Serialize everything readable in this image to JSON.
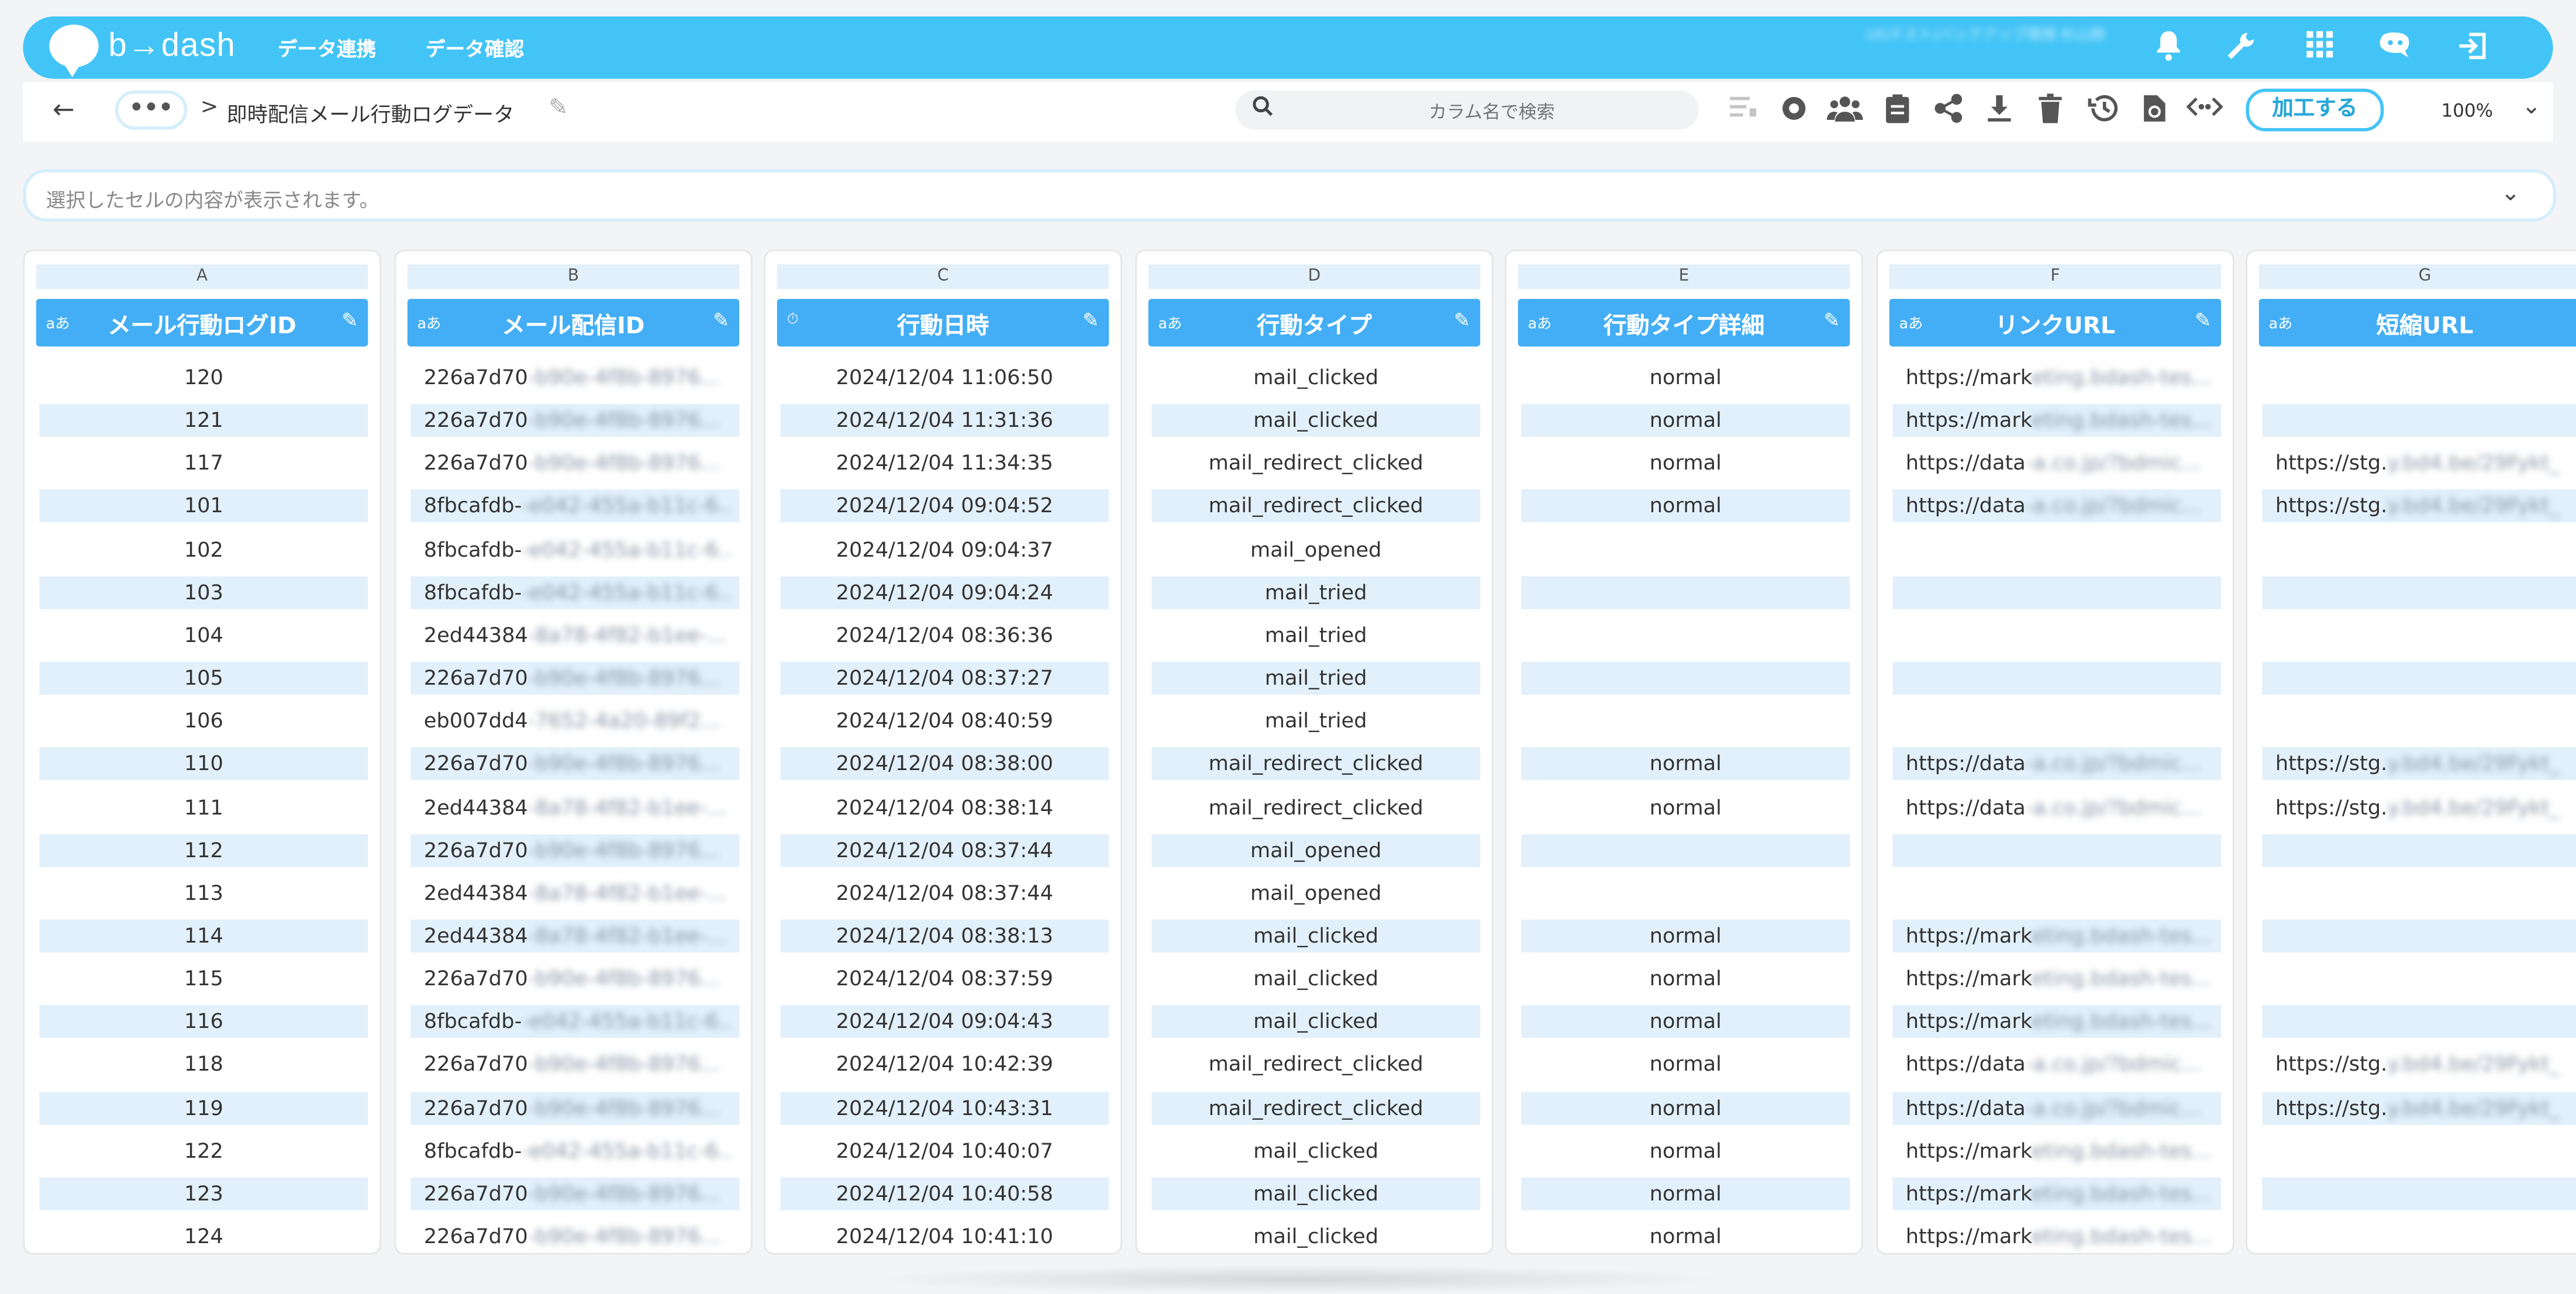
{
  "app": {
    "logo_text": "b→dash",
    "nav": [
      "データ連携",
      "データ確認"
    ],
    "user_blurred": "UGテスト/バックアップ環境 杉山剛"
  },
  "toolbar": {
    "back_icon": "arrow-left-icon",
    "more_label": "•••",
    "separator": ">",
    "title": "即時配信メール行動ログデータ",
    "search_placeholder": "カラム名で検索",
    "process_label": "加工する",
    "zoom": "100%"
  },
  "cell_bar": {
    "placeholder": "選択したセルの内容が表示されます。"
  },
  "columns": [
    {
      "letter": "A",
      "type": "aあ",
      "name": "メール行動ログID",
      "icon": "text-type-icon"
    },
    {
      "letter": "B",
      "type": "aあ",
      "name": "メール配信ID",
      "icon": "text-type-icon"
    },
    {
      "letter": "C",
      "type": "⏱",
      "name": "行動日時",
      "icon": "datetime-type-icon"
    },
    {
      "letter": "D",
      "type": "aあ",
      "name": "行動タイプ",
      "icon": "text-type-icon"
    },
    {
      "letter": "E",
      "type": "aあ",
      "name": "行動タイプ詳細",
      "icon": "text-type-icon"
    },
    {
      "letter": "F",
      "type": "aあ",
      "name": "リンクURL",
      "icon": "text-type-icon"
    },
    {
      "letter": "G",
      "type": "aあ",
      "name": "短縮URL",
      "icon": "text-type-icon"
    }
  ],
  "rows": [
    [
      "120",
      "226a7d70",
      "2024/12/04 11:06:50",
      "mail_clicked",
      "normal",
      "https://mark",
      ""
    ],
    [
      "121",
      "226a7d70",
      "2024/12/04 11:31:36",
      "mail_clicked",
      "normal",
      "https://mark",
      ""
    ],
    [
      "117",
      "226a7d70",
      "2024/12/04 11:34:35",
      "mail_redirect_clicked",
      "normal",
      "https://data",
      "https://stg."
    ],
    [
      "101",
      "8fbcafdb-",
      "2024/12/04 09:04:52",
      "mail_redirect_clicked",
      "normal",
      "https://data",
      "https://stg."
    ],
    [
      "102",
      "8fbcafdb-",
      "2024/12/04 09:04:37",
      "mail_opened",
      "",
      "",
      ""
    ],
    [
      "103",
      "8fbcafdb-",
      "2024/12/04 09:04:24",
      "mail_tried",
      "",
      "",
      ""
    ],
    [
      "104",
      "2ed44384",
      "2024/12/04 08:36:36",
      "mail_tried",
      "",
      "",
      ""
    ],
    [
      "105",
      "226a7d70",
      "2024/12/04 08:37:27",
      "mail_tried",
      "",
      "",
      ""
    ],
    [
      "106",
      "eb007dd4",
      "2024/12/04 08:40:59",
      "mail_tried",
      "",
      "",
      ""
    ],
    [
      "110",
      "226a7d70",
      "2024/12/04 08:38:00",
      "mail_redirect_clicked",
      "normal",
      "https://data",
      "https://stg."
    ],
    [
      "111",
      "2ed44384",
      "2024/12/04 08:38:14",
      "mail_redirect_clicked",
      "normal",
      "https://data",
      "https://stg."
    ],
    [
      "112",
      "226a7d70",
      "2024/12/04 08:37:44",
      "mail_opened",
      "",
      "",
      ""
    ],
    [
      "113",
      "2ed44384",
      "2024/12/04 08:37:44",
      "mail_opened",
      "",
      "",
      ""
    ],
    [
      "114",
      "2ed44384",
      "2024/12/04 08:38:13",
      "mail_clicked",
      "normal",
      "https://mark",
      ""
    ],
    [
      "115",
      "226a7d70",
      "2024/12/04 08:37:59",
      "mail_clicked",
      "normal",
      "https://mark",
      ""
    ],
    [
      "116",
      "8fbcafdb-",
      "2024/12/04 09:04:43",
      "mail_clicked",
      "normal",
      "https://mark",
      ""
    ],
    [
      "118",
      "226a7d70",
      "2024/12/04 10:42:39",
      "mail_redirect_clicked",
      "normal",
      "https://data",
      "https://stg."
    ],
    [
      "119",
      "226a7d70",
      "2024/12/04 10:43:31",
      "mail_redirect_clicked",
      "normal",
      "https://data",
      "https://stg."
    ],
    [
      "122",
      "8fbcafdb-",
      "2024/12/04 10:40:07",
      "mail_clicked",
      "normal",
      "https://mark",
      ""
    ],
    [
      "123",
      "226a7d70",
      "2024/12/04 10:40:58",
      "mail_clicked",
      "normal",
      "https://mark",
      ""
    ],
    [
      "124",
      "226a7d70",
      "2024/12/04 10:41:10",
      "mail_clicked",
      "normal",
      "https://mark",
      ""
    ]
  ],
  "colors": {
    "brand": "#43c4f6",
    "header": "#43aef5",
    "row_shade": "#e2f0fb"
  }
}
